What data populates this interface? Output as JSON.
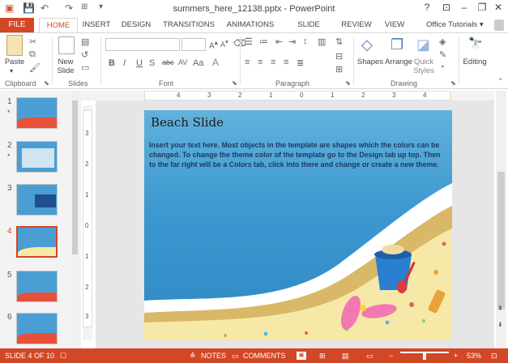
{
  "window": {
    "title": "summers_here_12138.pptx - PowerPoint",
    "help": "?",
    "minimize": "–",
    "restore": "❐",
    "close": "✕"
  },
  "quick_access": {
    "save": "💾",
    "undo": "↶",
    "redo": "↷",
    "customize": "▾"
  },
  "tabs": [
    "FILE",
    "HOME",
    "INSERT",
    "DESIGN",
    "TRANSITIONS",
    "ANIMATIONS",
    "SLIDE SHOW",
    "REVIEW",
    "VIEW"
  ],
  "account": "Office Tutorials ▾",
  "ribbon": {
    "clipboard": {
      "paste": "Paste",
      "label": "Clipboard"
    },
    "slides": {
      "new_slide": "New Slide",
      "label": "Slides"
    },
    "font": {
      "bold": "B",
      "italic": "I",
      "underline": "U",
      "shadow": "S",
      "strike": "abc",
      "case": "Aa",
      "label": "Font"
    },
    "paragraph": {
      "label": "Paragraph"
    },
    "drawing": {
      "shapes": "Shapes",
      "arrange": "Arrange",
      "quick_styles": "Quick Styles",
      "label": "Drawing"
    },
    "editing": {
      "label": "Editing"
    }
  },
  "ruler": {
    "h": [
      "4",
      "3",
      "2",
      "1",
      "0",
      "1",
      "2",
      "3",
      "4"
    ],
    "v": [
      "3",
      "2",
      "1",
      "0",
      "1",
      "2",
      "3"
    ]
  },
  "thumbnails": [
    {
      "num": "1",
      "star": "*"
    },
    {
      "num": "2",
      "star": "*"
    },
    {
      "num": "3",
      "star": ""
    },
    {
      "num": "4",
      "star": ""
    },
    {
      "num": "5",
      "star": ""
    },
    {
      "num": "6",
      "star": ""
    }
  ],
  "slide": {
    "title": "Beach Slide",
    "body": "Insert your text here. Most objects in the template are shapes which the colors can be changed.  To change the theme color of the template go to the Design tab up top. Then to the far right will be a Colors tab, click into there and change or create a new theme."
  },
  "statusbar": {
    "slide_info": "SLIDE 4 OF 10",
    "notes": "NOTES",
    "comments": "COMMENTS",
    "zoom": "53%",
    "zoom_minus": "−",
    "zoom_plus": "+"
  },
  "colors": {
    "accent": "#d24726",
    "slide_blue": "#3c98d0",
    "sand": "#f6e9a8"
  }
}
